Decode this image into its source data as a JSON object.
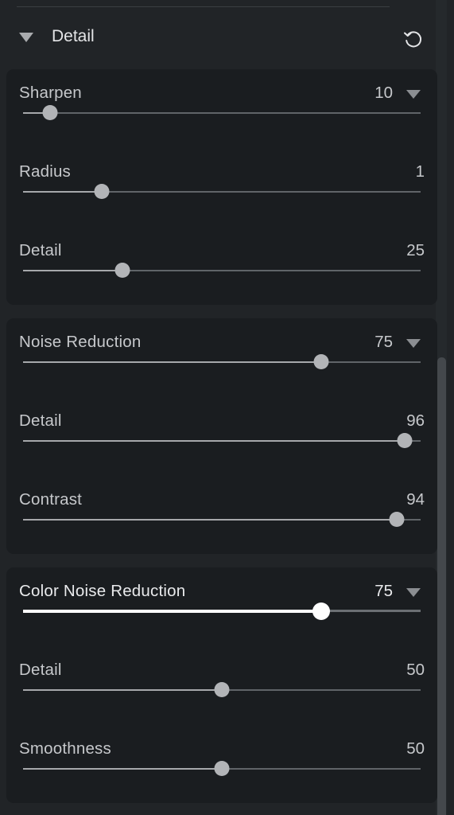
{
  "section": {
    "title": "Detail",
    "collapse_icon": "triangle-down-icon",
    "reset_icon": "reset-icon"
  },
  "groups": [
    {
      "name": "sharpen",
      "sliders": [
        {
          "label": "Sharpen",
          "value": "10",
          "min": 0,
          "max": 150,
          "position": 0.067,
          "has_caret": true
        },
        {
          "label": "Radius",
          "value": "1",
          "min": 0.5,
          "max": 3.0,
          "position": 0.197,
          "has_caret": false
        },
        {
          "label": "Detail",
          "value": "25",
          "min": 0,
          "max": 100,
          "position": 0.25,
          "has_caret": false
        }
      ]
    },
    {
      "name": "noise-reduction",
      "sliders": [
        {
          "label": "Noise Reduction",
          "value": "75",
          "min": 0,
          "max": 100,
          "position": 0.75,
          "has_caret": true
        },
        {
          "label": "Detail",
          "value": "96",
          "min": 0,
          "max": 100,
          "position": 0.96,
          "has_caret": false
        },
        {
          "label": "Contrast",
          "value": "94",
          "min": 0,
          "max": 100,
          "position": 0.94,
          "has_caret": false
        }
      ]
    },
    {
      "name": "color-noise-reduction",
      "sliders": [
        {
          "label": "Color Noise Reduction",
          "value": "75",
          "min": 0,
          "max": 100,
          "position": 0.75,
          "has_caret": true,
          "active": true
        },
        {
          "label": "Detail",
          "value": "50",
          "min": 0,
          "max": 100,
          "position": 0.5,
          "has_caret": false
        },
        {
          "label": "Smoothness",
          "value": "50",
          "min": 0,
          "max": 100,
          "position": 0.5,
          "has_caret": false
        }
      ]
    }
  ],
  "colors": {
    "panel_bg": "#212427",
    "card_bg": "#1a1d20",
    "active_thumb": "#ffffff",
    "thumb": "#b2b4b7"
  }
}
